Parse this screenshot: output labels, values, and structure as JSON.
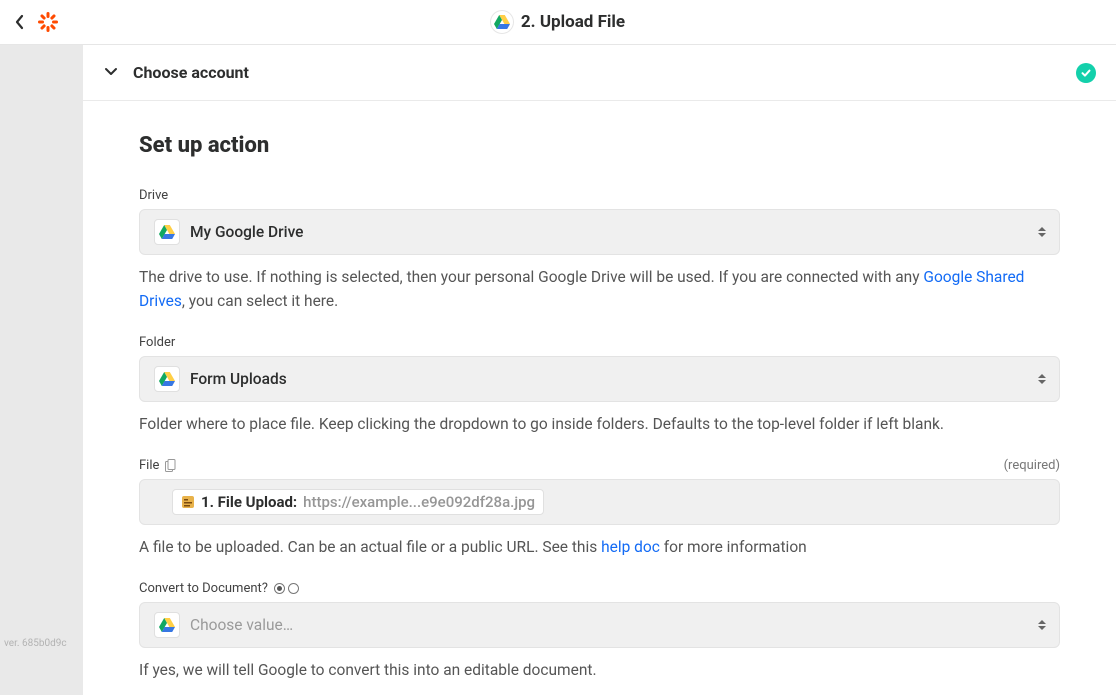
{
  "header": {
    "step_number": "2.",
    "title": "Upload File"
  },
  "account_section": {
    "title": "Choose account"
  },
  "setup": {
    "title": "Set up action",
    "drive": {
      "label": "Drive",
      "value": "My Google Drive",
      "help_prefix": "The drive to use. If nothing is selected, then your personal Google Drive will be used. If you are connected with any ",
      "help_link_text": "Google Shared Drives",
      "help_suffix": ", you can select it here."
    },
    "folder": {
      "label": "Folder",
      "value": "Form Uploads",
      "help": "Folder where to place file. Keep clicking the dropdown to go inside folders. Defaults to the top-level folder if left blank."
    },
    "file": {
      "label": "File",
      "required_text": "(required)",
      "pill_label": "1. File Upload:",
      "pill_value": "https://example...e9e092df28a.jpg",
      "help_prefix": "A file to be uploaded. Can be an actual file or a public URL. See this ",
      "help_link_text": "help doc",
      "help_suffix": " for more information"
    },
    "convert": {
      "label": "Convert to Document?",
      "placeholder": "Choose value…",
      "help": "If yes, we will tell Google to convert this into an editable document."
    }
  },
  "version": "ver. 685b0d9c"
}
